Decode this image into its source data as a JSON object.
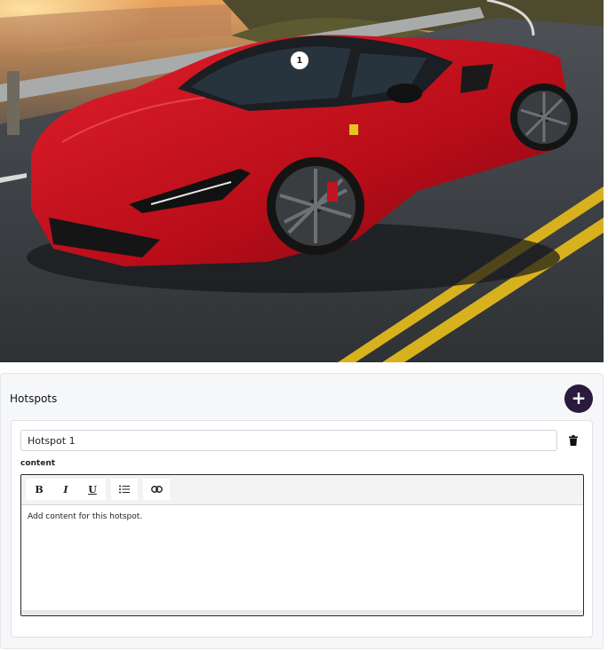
{
  "hero": {
    "image_subject": "red sports car on coastal road",
    "hotspot_markers": [
      {
        "label": "1"
      }
    ]
  },
  "panel": {
    "title": "Hotspots",
    "add_icon": "plus-icon",
    "hotspots": [
      {
        "name": "Hotspot 1",
        "content_label": "content",
        "content_text": "Add content for this hotspot.",
        "delete_icon": "trash-icon"
      }
    ]
  },
  "editor_toolbar": {
    "bold_label": "B",
    "italic_label": "I",
    "underline_label": "U",
    "list_icon": "bulleted-list-icon",
    "link_icon": "link-icon"
  },
  "colors": {
    "accent": "#2b1a3d",
    "panel_bg": "#f6f7f9",
    "car_red": "#c0101c"
  }
}
